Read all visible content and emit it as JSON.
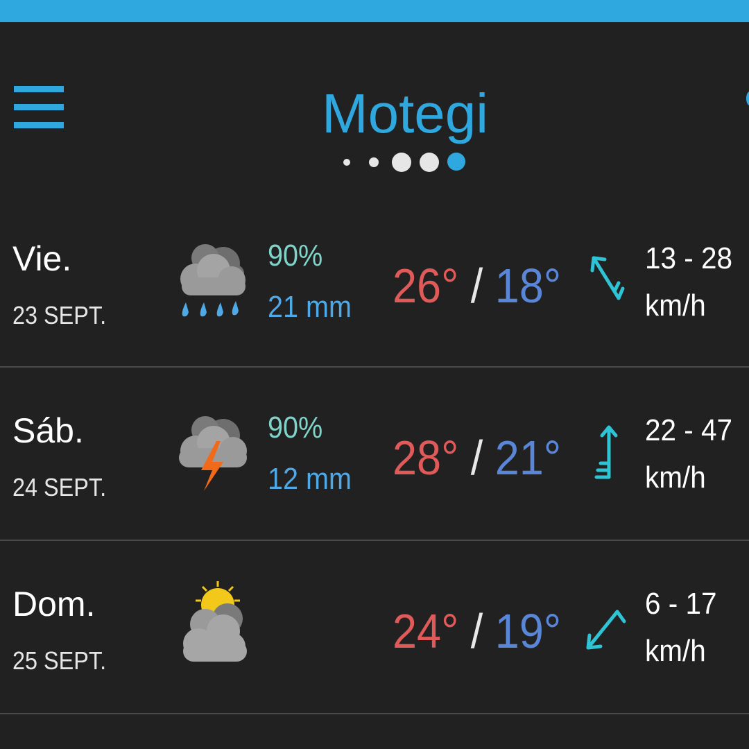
{
  "header": {
    "city": "Motegi",
    "page_count": 5,
    "active_page": 5
  },
  "colors": {
    "accent": "#2fa8e0",
    "max_temp": "#e05a5a",
    "min_temp": "#5a86d8",
    "precip_prob": "#7fd3c8",
    "precip_amount": "#4fa9e6",
    "wind_arrow": "#2ec4d6"
  },
  "days": [
    {
      "day": "Vie.",
      "date": "23 SEPT.",
      "icon": "rain-cloud-icon",
      "precip_prob": "90%",
      "precip_amount": "21 mm",
      "temp_max": "26°",
      "temp_sep": "/",
      "temp_min": "18°",
      "wind_icon": "wind-arrow-northwest-icon",
      "wind_range": "13 - 28",
      "wind_unit": "km/h"
    },
    {
      "day": "Sáb.",
      "date": "24 SEPT.",
      "icon": "thunderstorm-cloud-icon",
      "precip_prob": "90%",
      "precip_amount": "12 mm",
      "temp_max": "28°",
      "temp_sep": "/",
      "temp_min": "21°",
      "wind_icon": "wind-arrow-north-icon",
      "wind_range": "22 - 47",
      "wind_unit": "km/h"
    },
    {
      "day": "Dom.",
      "date": "25 SEPT.",
      "icon": "partly-cloudy-icon",
      "precip_prob": "",
      "precip_amount": "",
      "temp_max": "24°",
      "temp_sep": "/",
      "temp_min": "19°",
      "wind_icon": "wind-arrow-northeast-icon",
      "wind_range": "6 - 17",
      "wind_unit": "km/h"
    }
  ]
}
